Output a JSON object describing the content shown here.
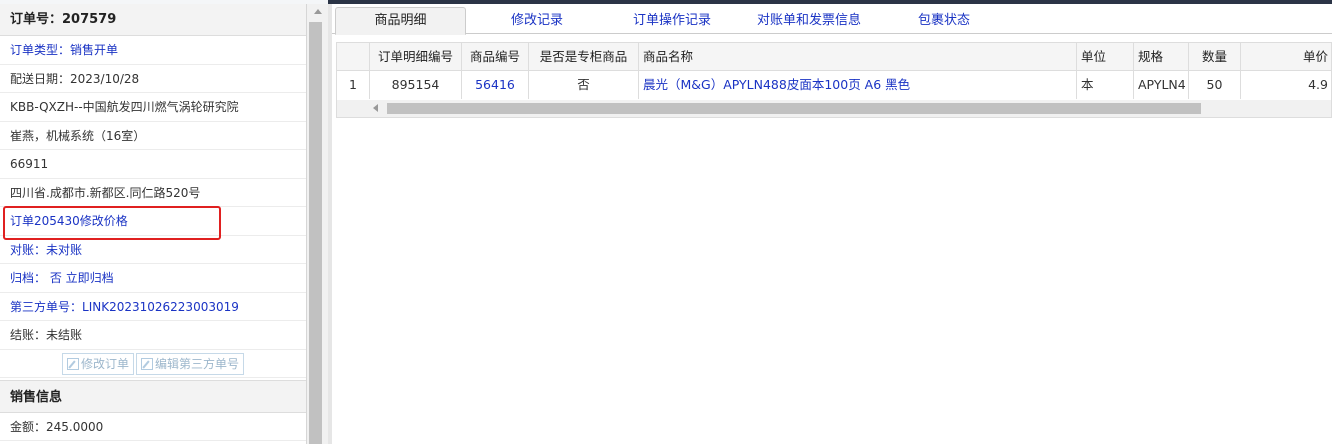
{
  "order_panel": {
    "header": "订单号：207579",
    "rows": [
      {
        "label": "订单类型：",
        "value": "销售开单",
        "blue": true
      },
      {
        "label": "配送日期：",
        "value": "2023/10/28",
        "blue": false
      },
      {
        "label": "",
        "value": "KBB-QXZH--中国航发四川燃气涡轮研究院",
        "blue": false
      },
      {
        "label": "",
        "value": "崔燕，机械系统（16室）",
        "blue": false
      },
      {
        "label": "",
        "value": "66911",
        "blue": false
      },
      {
        "label": "",
        "value": "四川省.成都市.新都区.同仁路520号",
        "blue": false
      },
      {
        "label": "",
        "value": "订单205430修改价格",
        "blue": true
      },
      {
        "label": "对账：",
        "value": "未对账",
        "blue": true
      },
      {
        "label": "归档：",
        "value": " 否 立即归档",
        "blue": true
      },
      {
        "label": "第三方单号：",
        "value": "LINK20231026223003019",
        "blue": true
      },
      {
        "label": "结账：",
        "value": "未结账",
        "blue": false
      }
    ],
    "buttons": {
      "edit_order": "修改订单",
      "edit_third_party": "编辑第三方单号"
    },
    "sales_section": "销售信息",
    "amount": "金额：245.0000"
  },
  "tabs": [
    "商品明细",
    "修改记录",
    "订单操作记录",
    "对账单和发票信息",
    "包裹状态"
  ],
  "grid": {
    "columns": [
      "",
      "订单明细编号",
      "商品编号",
      "是否是专柜商品",
      "商品名称",
      "单位",
      "规格",
      "数量",
      "单价"
    ],
    "rows": [
      [
        "1",
        "895154",
        "56416",
        "否",
        "晨光（M&G）APYLN488皮面本100页 A6 黑色",
        "本",
        "APYLN4",
        "50",
        "4.9"
      ]
    ]
  },
  "colors": {
    "link": "#1a33c4",
    "highlight": "#e02020",
    "topbar": "#2b3446"
  }
}
